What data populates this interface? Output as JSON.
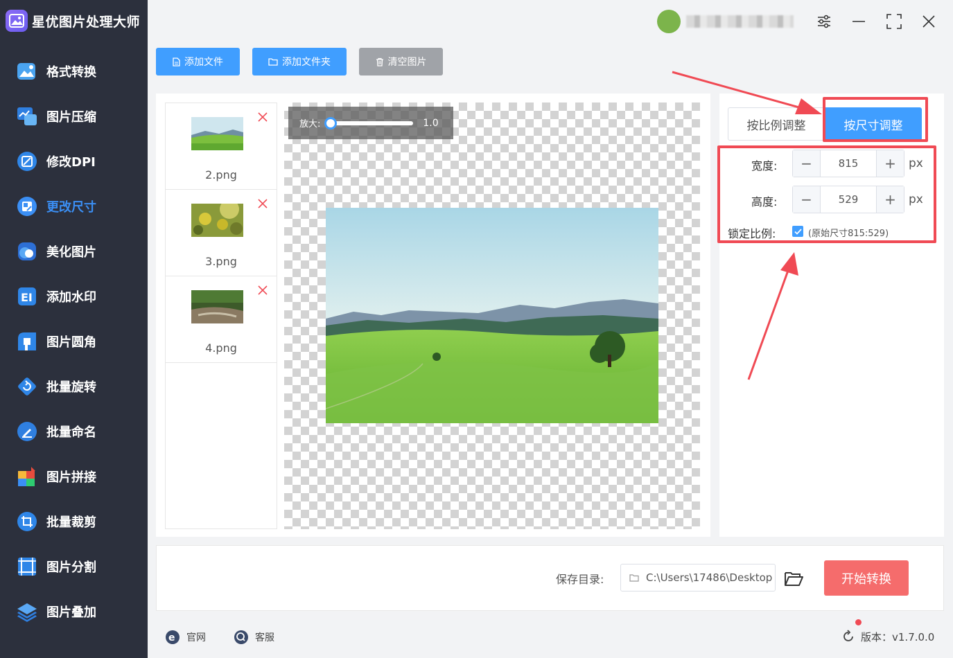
{
  "app": {
    "title": "星优图片处理大师"
  },
  "sidebar": {
    "items": [
      {
        "label": "格式转换",
        "icon": "format-convert-icon"
      },
      {
        "label": "图片压缩",
        "icon": "compress-icon"
      },
      {
        "label": "修改DPI",
        "icon": "dpi-icon"
      },
      {
        "label": "更改尺寸",
        "icon": "resize-icon",
        "active": true
      },
      {
        "label": "美化图片",
        "icon": "beautify-icon"
      },
      {
        "label": "添加水印",
        "icon": "watermark-icon"
      },
      {
        "label": "图片圆角",
        "icon": "round-corner-icon"
      },
      {
        "label": "批量旋转",
        "icon": "rotate-icon"
      },
      {
        "label": "批量命名",
        "icon": "rename-icon"
      },
      {
        "label": "图片拼接",
        "icon": "stitch-icon"
      },
      {
        "label": "批量裁剪",
        "icon": "crop-icon"
      },
      {
        "label": "图片分割",
        "icon": "split-icon"
      },
      {
        "label": "图片叠加",
        "icon": "overlay-icon"
      }
    ],
    "active_color": "#3b8ff5"
  },
  "toolbar": {
    "add_file": "添加文件",
    "add_folder": "添加文件夹",
    "clear": "清空图片"
  },
  "files": [
    {
      "name": "2.png"
    },
    {
      "name": "3.png"
    },
    {
      "name": "4.png"
    }
  ],
  "preview": {
    "zoom_label": "放大:",
    "zoom_value": "1.0"
  },
  "settings": {
    "mode_ratio": "按比例调整",
    "mode_size": "按尺寸调整",
    "width_label": "宽度:",
    "width_value": "815",
    "height_label": "高度:",
    "height_value": "529",
    "unit": "px",
    "lock_label": "锁定比例:",
    "lock_checked": true,
    "original_size_note": "(原始尺寸815:529)"
  },
  "bottom": {
    "save_label": "保存目录:",
    "save_path": "C:\\Users\\17486\\Desktop",
    "start_button": "开始转换"
  },
  "footer": {
    "website": "官网",
    "support": "客服",
    "version": "版本：v1.7.0.0"
  },
  "colors": {
    "primary": "#409eff",
    "danger": "#f56c6c",
    "sidebar_bg": "#2c303d",
    "annotation_red": "#f04a54"
  }
}
